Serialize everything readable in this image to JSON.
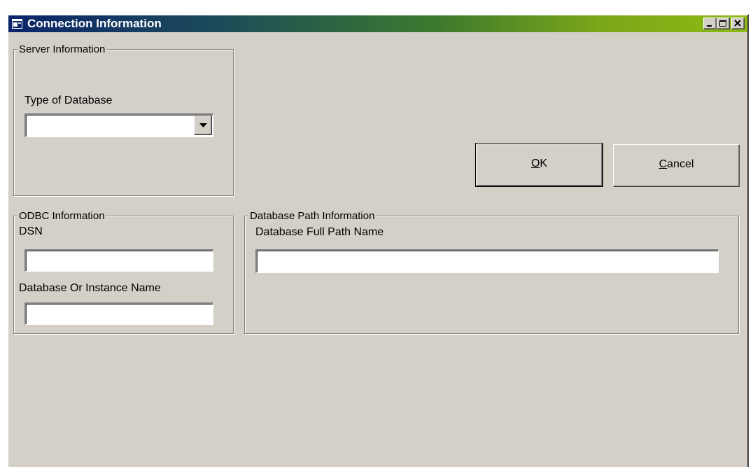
{
  "window": {
    "title": "Connection Information",
    "controls": {
      "minimize_icon": "minimize-icon",
      "maximize_icon": "maximize-icon",
      "close_icon": "close-icon"
    },
    "colors": {
      "face": "#d4d0c8",
      "title_start": "#0a246a",
      "title_end": "#8fbb14"
    }
  },
  "server_group": {
    "legend": "Server Information",
    "type_label": "Type of Database",
    "type_value": ""
  },
  "buttons": {
    "ok_mnemonic": "O",
    "ok_rest": "K",
    "cancel_mnemonic": "C",
    "cancel_rest": "ancel"
  },
  "odbc_group": {
    "legend": "ODBC Information",
    "dsn_label": "DSN",
    "dsn_value": "",
    "db_label": "Database Or Instance Name",
    "db_value": ""
  },
  "path_group": {
    "legend": "Database Path Information",
    "path_label": "Database Full Path Name",
    "path_value": ""
  }
}
